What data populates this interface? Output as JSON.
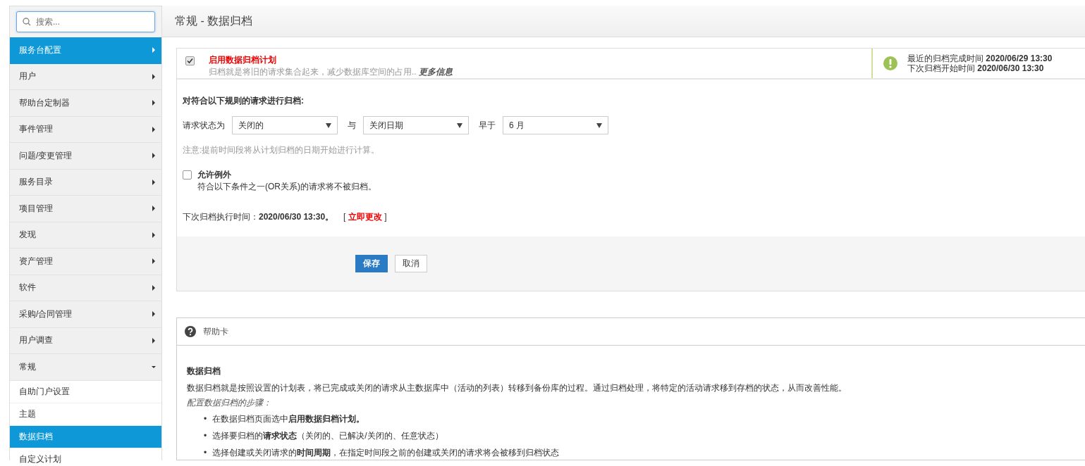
{
  "search": {
    "placeholder": "搜索..."
  },
  "sidebar": {
    "items": [
      {
        "label": "服务台配置",
        "selected": true,
        "expanded": false
      },
      {
        "label": "用户",
        "selected": false,
        "expanded": false
      },
      {
        "label": "帮助台定制器",
        "selected": false,
        "expanded": false
      },
      {
        "label": "事件管理",
        "selected": false,
        "expanded": false
      },
      {
        "label": "问题/变更管理",
        "selected": false,
        "expanded": false
      },
      {
        "label": "服务目录",
        "selected": false,
        "expanded": false
      },
      {
        "label": "项目管理",
        "selected": false,
        "expanded": false
      },
      {
        "label": "发现",
        "selected": false,
        "expanded": false
      },
      {
        "label": "资产管理",
        "selected": false,
        "expanded": false
      },
      {
        "label": "软件",
        "selected": false,
        "expanded": false
      },
      {
        "label": "采购/合同管理",
        "selected": false,
        "expanded": false
      },
      {
        "label": "用户调查",
        "selected": false,
        "expanded": false
      },
      {
        "label": "常规",
        "selected": false,
        "expanded": true,
        "children": [
          {
            "label": "自助门户设置",
            "selected": false
          },
          {
            "label": "主题",
            "selected": false
          },
          {
            "label": "数据归档",
            "selected": true
          },
          {
            "label": "自定义计划",
            "selected": false
          }
        ]
      }
    ]
  },
  "header": {
    "title": "常规 - 数据归档"
  },
  "archive_panel": {
    "enable": {
      "checked": true,
      "title": "启用数据归档计划",
      "description": "归档就是将旧的请求集合起来，减少数据库空间的占用..",
      "more_link": "更多信息"
    },
    "status": [
      {
        "label": "最近的归档完成时间",
        "value": "2020/06/29 13:30"
      },
      {
        "label": "下次归档开始时间",
        "value": "2020/06/30 13:30"
      }
    ],
    "rules_heading": "对符合以下规则的请求进行归档:",
    "criteria": [
      {
        "label": "请求状态为",
        "value": "关闭的"
      },
      {
        "label": "与",
        "value": "关闭日期"
      },
      {
        "label": "早于",
        "value": "6 月"
      }
    ],
    "note": "注意:提前时间段将从计划归档的日期开始进行计算。",
    "exception": {
      "checked": false,
      "title": "允许例外",
      "description": "符合以下条件之一(OR关系)的请求将不被归档。"
    },
    "next_run": {
      "label": "下次归档执行时间：",
      "value": "2020/06/30 13:30。",
      "bracket_open": "[",
      "link": "立即更改",
      "bracket_close": "]"
    },
    "buttons": [
      {
        "label": "保存",
        "kind": "primary"
      },
      {
        "label": "取消",
        "kind": "secondary"
      }
    ]
  },
  "help_card": {
    "title": "帮助卡",
    "heading": "数据归档",
    "paragraph": "数据归档就是按照设置的计划表，将已完成或关闭的请求从主数据库中（活动的列表）转移到备份库的过程。通过归档处理，将特定的活动请求移到存档的状态，从而改善性能。",
    "steps_title": "配置数据归档的步骤：",
    "steps": [
      {
        "bullet": "•",
        "text": "在数据归档页面选中**启用数据归档计划。**"
      },
      {
        "bullet": "•",
        "text": "选择要归档的**请求状态**（关闭的、已解决/关闭的、任意状态）"
      },
      {
        "bullet": "•",
        "text": "选择创建或关闭请求的**时间周期**，在指定时间段之前的创建或关闭的请求将会被移到归档状态"
      }
    ]
  }
}
